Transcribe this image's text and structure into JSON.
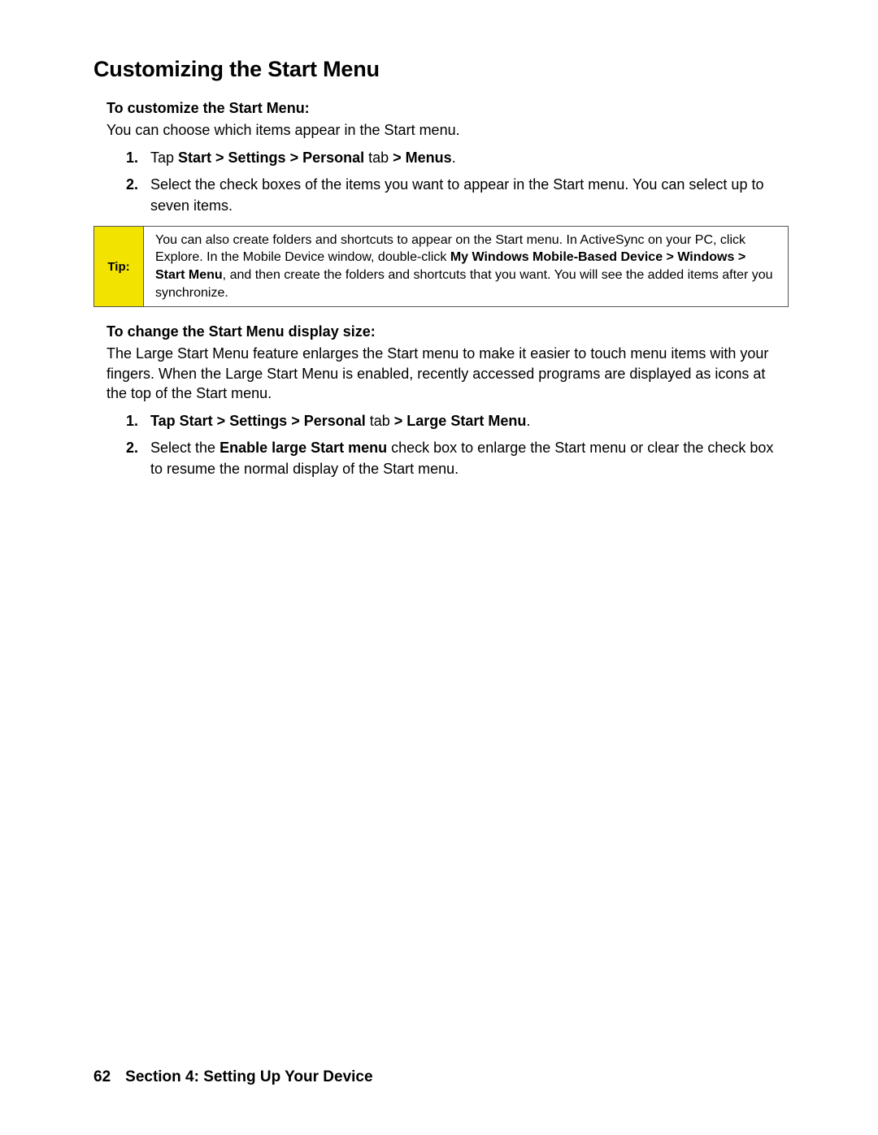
{
  "heading": "Customizing the Start Menu",
  "section1": {
    "subheading": "To customize the Start Menu:",
    "intro": "You can choose which items appear in the Start menu.",
    "step1_prefix": "Tap ",
    "step1_bold1": "Start > Settings > Personal ",
    "step1_mid": "tab",
    "step1_bold2": " > Menus",
    "step1_suffix": ".",
    "step2": "Select the check boxes of the items you want to appear in the Start menu. You can select up to seven items."
  },
  "tip": {
    "label": "Tip:",
    "text_pre": "You can also create folders and shortcuts to appear on the Start menu. In ActiveSync on your PC, click Explore. In the Mobile Device window, double-click ",
    "text_bold": "My Windows Mobile-Based Device > Windows > Start Menu",
    "text_post": ", and then create the folders and shortcuts that you want. You will see the added items after you synchronize."
  },
  "section2": {
    "subheading": "To change the Start Menu display size:",
    "intro": "The Large Start Menu feature enlarges the Start menu to make it easier to touch menu items with your fingers. When the Large Start Menu is enabled, recently accessed programs are displayed as icons at the top of the Start menu.",
    "step1_bold1": "Tap Start > Settings > Personal ",
    "step1_mid": "tab",
    "step1_bold2": " > Large Start Menu",
    "step1_suffix": ".",
    "step2_pre": "Select the ",
    "step2_bold": "Enable large Start menu",
    "step2_post": " check box to enlarge the Start menu or clear the check box to resume the normal display of the Start menu."
  },
  "footer": {
    "page": "62",
    "title": "Section 4: Setting Up Your Device"
  }
}
